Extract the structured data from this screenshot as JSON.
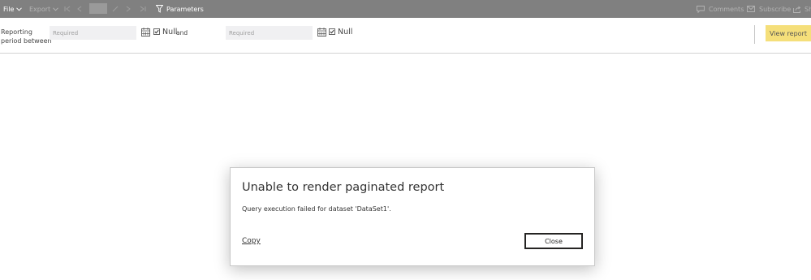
{
  "toolbar": {
    "file_label": "File",
    "export_label": "Export",
    "parameters_label": "Parameters",
    "comments_label": "Comments",
    "subscribe_label": "Subscribe",
    "share_label": "Sh"
  },
  "parameters": {
    "label_line1": "Reporting",
    "label_line2": "period between",
    "start": {
      "placeholder": "Required",
      "null_checked": true,
      "null_label": "Null"
    },
    "and_label": "and",
    "end": {
      "placeholder": "Required",
      "null_checked": true,
      "null_label": "Null"
    },
    "view_report_label": "View report"
  },
  "dialog": {
    "title": "Unable to render paginated report",
    "message": "Query execution failed for dataset 'DataSet1'.",
    "copy_label": "Copy",
    "close_label": "Close"
  },
  "colors": {
    "toolbar_bg": "#808080",
    "view_report_bg": "#f5df7a",
    "input_bg": "#f0f0f2"
  }
}
